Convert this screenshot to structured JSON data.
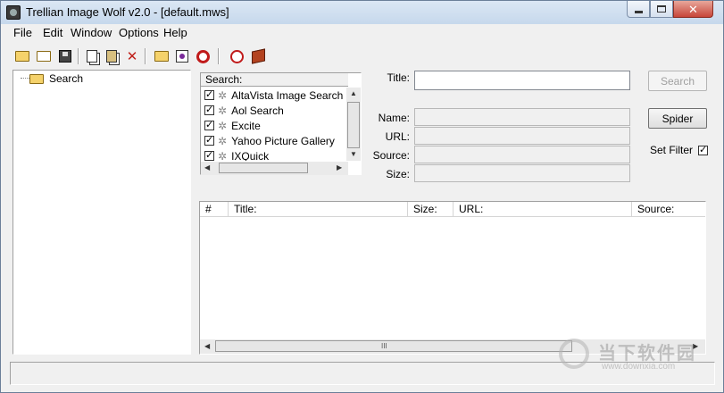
{
  "window": {
    "title": "Trellian Image Wolf v2.0 - [default.mws]"
  },
  "menu": {
    "items": [
      "File",
      "Edit",
      "Window",
      "Options",
      "Help"
    ]
  },
  "toolbar": {
    "icons": [
      "new-folder-icon",
      "open-folder-icon",
      "save-icon",
      "copy-icon",
      "paste-icon",
      "delete-icon",
      "folder-icon",
      "properties-icon",
      "target-icon",
      "clock-icon",
      "book-icon"
    ]
  },
  "tree": {
    "root_label": "Search"
  },
  "engines": {
    "header": "Search:",
    "items": [
      {
        "label": "AltaVista Image Search",
        "checked": true
      },
      {
        "label": "Aol Search",
        "checked": true
      },
      {
        "label": "Excite",
        "checked": true
      },
      {
        "label": "Yahoo Picture Gallery",
        "checked": true
      },
      {
        "label": "IXQuick",
        "checked": true
      }
    ]
  },
  "form": {
    "title_label": "Title:",
    "title_value": "",
    "name_label": "Name:",
    "url_label": "URL:",
    "source_label": "Source:",
    "size_label": "Size:",
    "search_button": "Search",
    "spider_button": "Spider",
    "set_filter_label": "Set Filter",
    "set_filter_checked": true
  },
  "results": {
    "columns": [
      "#",
      "Title:",
      "Size:",
      "URL:",
      "Source:"
    ],
    "rows": []
  },
  "status": {
    "text": ""
  },
  "watermark": {
    "text": "当下软件园",
    "url": "www.downxia.com"
  }
}
